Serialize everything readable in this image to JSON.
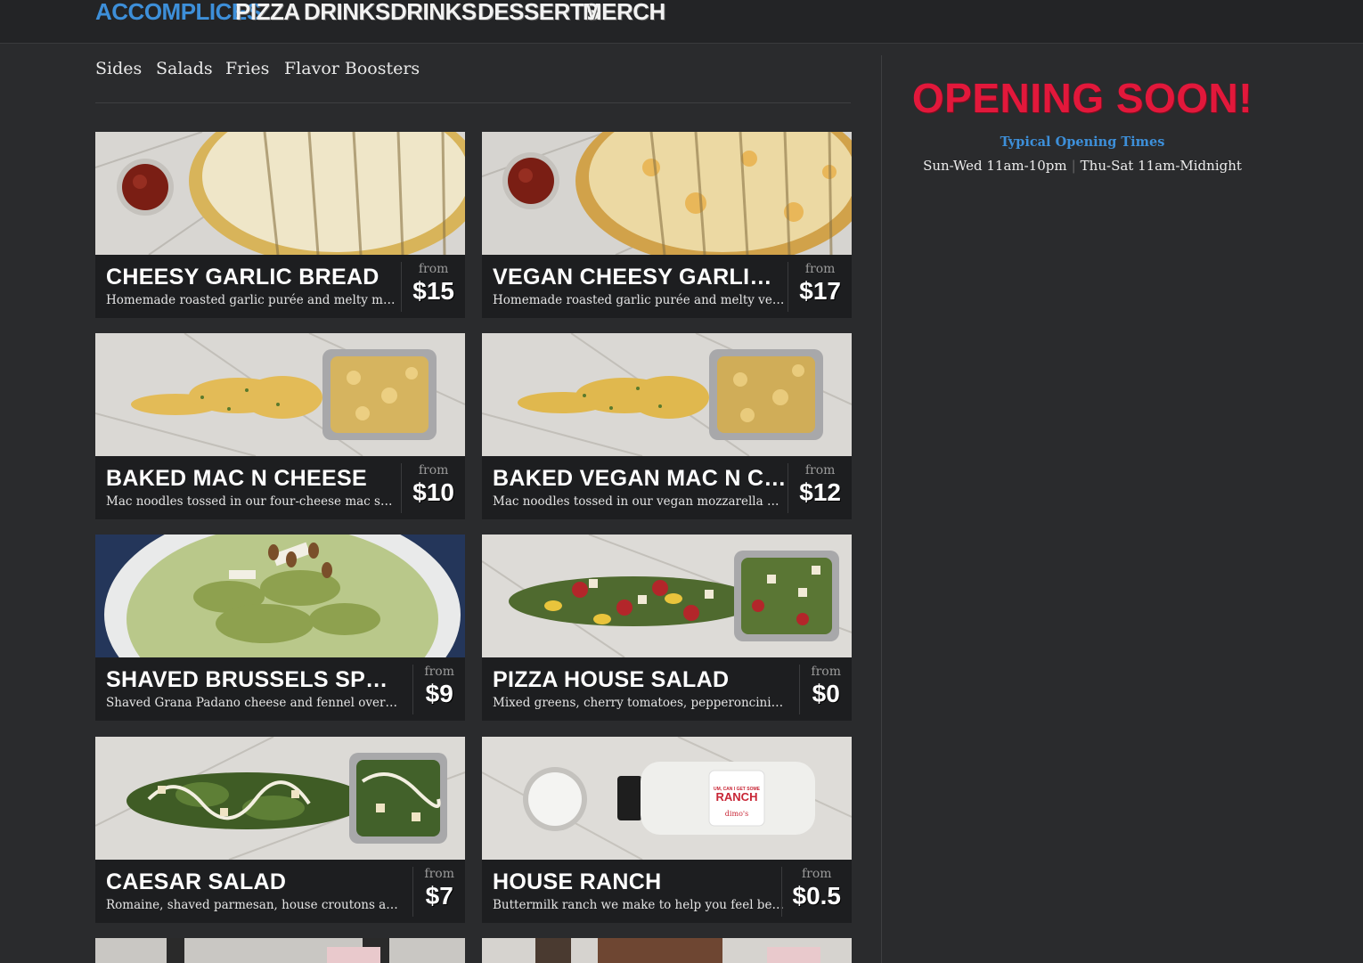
{
  "nav": {
    "items": [
      {
        "label": "Accomplices",
        "active": true
      },
      {
        "label": "Pizza"
      },
      {
        "label": "Drinks"
      },
      {
        "label": "Drinks"
      },
      {
        "label": "Desserts"
      },
      {
        "label": "Merch"
      }
    ]
  },
  "subnav": {
    "items": [
      "Sides",
      "Salads",
      "Fries",
      "Flavor Boosters"
    ]
  },
  "menu": {
    "items": [
      {
        "title": "Cheesy Garlic Bread",
        "desc": "Homemade roasted garlic purée and melty mozzarella",
        "from": "from",
        "price": "$15",
        "image": "garlic-bread"
      },
      {
        "title": "Vegan Cheesy Garlic Bread",
        "desc": "Homemade roasted garlic purée and melty vegan cheese",
        "from": "from",
        "price": "$17",
        "image": "vegan-garlic-bread"
      },
      {
        "title": "Baked Mac N Cheese",
        "desc": "Mac noodles tossed in our four-cheese mac sauce",
        "from": "from",
        "price": "$10",
        "image": "mac-n-cheese"
      },
      {
        "title": "Baked Vegan Mac N Cheese",
        "desc": "Mac noodles tossed in our vegan mozzarella sauce",
        "from": "from",
        "price": "$12",
        "image": "vegan-mac-n-cheese"
      },
      {
        "title": "Shaved Brussels Sprouts",
        "desc": "Shaved Grana Padano cheese and fennel over brussels",
        "from": "from",
        "price": "$9",
        "image": "brussels-sprouts"
      },
      {
        "title": "Pizza House Salad",
        "desc": "Mixed greens, cherry tomatoes, pepperoncini and croutons",
        "from": "from",
        "price": "$0",
        "image": "house-salad"
      },
      {
        "title": "Caesar Salad",
        "desc": "Romaine, shaved parmesan, house croutons and dressing",
        "from": "from",
        "price": "$7",
        "image": "caesar-salad"
      },
      {
        "title": "House Ranch",
        "desc": "Buttermilk ranch we make to help you feel better",
        "from": "from",
        "price": "$0.5",
        "image": "house-ranch",
        "bottle_label": "RANCH",
        "bottle_top": "UM, CAN I GET SOME",
        "bottle_brand": "dimo's"
      }
    ]
  },
  "side": {
    "opening": "Opening Soon!",
    "typical_label": "Typical Opening Times",
    "hours_a": "Sun-Wed 11am-10pm",
    "hours_sep": "|",
    "hours_b": "Thu-Sat 11am-Midnight"
  },
  "colors": {
    "accent_blue": "#3d8fd9",
    "opening_red": "#e2183b",
    "background": "#2a2b2d",
    "card_bg": "#1d1e20"
  }
}
